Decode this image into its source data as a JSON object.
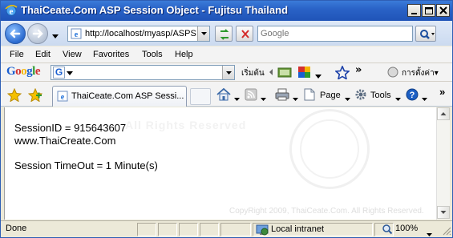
{
  "window": {
    "title": "ThaiCeate.Com ASP Session Object - Fujitsu Thailand"
  },
  "address_bar": {
    "url": "http://localhost/myasp/ASPS",
    "search_placeholder": "Google"
  },
  "menu": {
    "items": [
      "File",
      "Edit",
      "View",
      "Favorites",
      "Tools",
      "Help"
    ]
  },
  "google_toolbar": {
    "logo": "Google",
    "search_icon_letter": "G",
    "start_label": "เริ่มต้น",
    "more_label": "»",
    "settings_label": "การตั้งค่า▾"
  },
  "tabs": {
    "active_tab_label": "ThaiCeate.Com ASP Sessi..."
  },
  "command_bar": {
    "page_label": "Page",
    "tools_label": "Tools",
    "more_label": "»"
  },
  "page": {
    "session_id_line": "SessionID = 915643607",
    "site_line": "www.ThaiCreate.Com",
    "timeout_line": "Session TimeOut = 1 Minute(s)",
    "watermark_text": "All Rights Reserved",
    "copyright": "CopyRight 2009, ThaiCeate.Com. All Rights Reserved."
  },
  "status": {
    "left_text": "Done",
    "zone_text": "Local intranet",
    "zoom_text": "100%"
  },
  "colors": {
    "titlebar": "#2a63c7",
    "chrome": "#ece9d8",
    "link_blue": "#1a5fd1"
  }
}
